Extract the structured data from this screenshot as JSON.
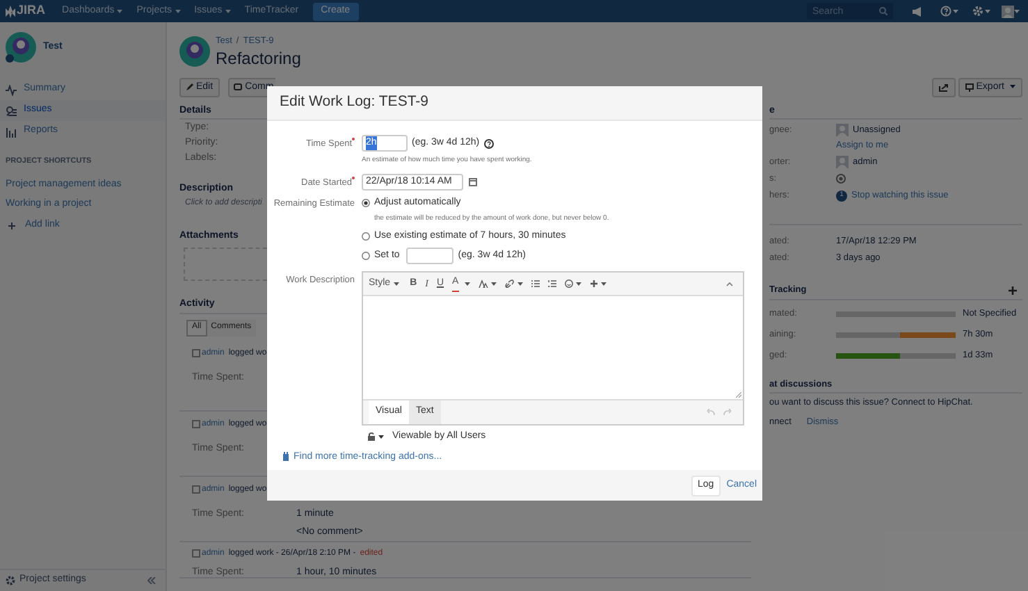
{
  "header": {
    "logo": "JIRA",
    "menus": [
      {
        "label": "Dashboards",
        "dropdown": true
      },
      {
        "label": "Projects",
        "dropdown": true
      },
      {
        "label": "Issues",
        "dropdown": true
      },
      {
        "label": "TimeTracker",
        "dropdown": false
      }
    ],
    "create": "Create",
    "search": {
      "placeholder": "Search"
    }
  },
  "sidebar": {
    "project": "Test",
    "items": [
      {
        "label": "Summary",
        "selected": false
      },
      {
        "label": "Issues",
        "selected": true
      },
      {
        "label": "Reports",
        "selected": false
      }
    ],
    "shortcuts_title": "PROJECT SHORTCUTS",
    "shortcuts": [
      "Project management ideas",
      "Working in a project"
    ],
    "add_link": "Add link",
    "settings": "Project settings"
  },
  "issue": {
    "breadcrumbs": [
      "Test",
      "TEST-9"
    ],
    "separator": "/",
    "title": "Refactoring",
    "actions": [
      "Edit",
      "Comm"
    ],
    "export": "Export"
  },
  "details": {
    "title": "Details",
    "fields": [
      "Type:",
      "Priority:",
      "Labels:"
    ]
  },
  "description": {
    "title": "Description",
    "placeholder": "Click to add descripti"
  },
  "attachments": {
    "title": "Attachments"
  },
  "activity": {
    "title": "Activity",
    "tabs": [
      {
        "label": "All",
        "selected": true
      },
      {
        "label": "Comments",
        "selected": false
      }
    ],
    "entries": [
      {
        "user": "admin",
        "text": "logged wo",
        "fields": [
          {
            "label": "Time Spent:"
          }
        ]
      },
      {
        "user": "admin",
        "text": "logged wo",
        "fields": [
          {
            "label": "Time Spent:"
          }
        ]
      },
      {
        "user": "admin",
        "text": "logged wo",
        "fields": [
          {
            "label": "Time Spent:",
            "value": "1 minute",
            "comment": "<No comment>"
          }
        ]
      },
      {
        "user": "admin",
        "text": "logged work - 26/Apr/18 2:10 PM -",
        "edited": "edited",
        "fields": [
          {
            "label": "Time Spent:",
            "value": "1 hour, 10 minutes"
          }
        ]
      }
    ]
  },
  "people": {
    "title": "e",
    "assignee": {
      "label": "gnee:",
      "value": "Unassigned",
      "action": "Assign to me"
    },
    "reporter": {
      "label": "orter:",
      "value": "admin"
    },
    "votes": {
      "label": "s:"
    },
    "watchers": {
      "label": "hers:",
      "count": "1",
      "action": "Stop watching this issue"
    }
  },
  "dates": [
    {
      "label": "ated:",
      "value": "17/Apr/18 12:29 PM"
    },
    {
      "label": "ated:",
      "value": "3 days ago"
    }
  ],
  "time_tracking": {
    "title": "Tracking",
    "rows": [
      {
        "label": "mated:",
        "kind": "empty",
        "value": "Not Specified"
      },
      {
        "label": "aining:",
        "kind": "remaining",
        "level": 0.47,
        "value": "7h 30m"
      },
      {
        "label": "ged:",
        "kind": "logged",
        "level": 0.54,
        "value": "1d 33m"
      }
    ]
  },
  "hipchat": {
    "title": "at discussions",
    "text": "ou want to discuss this issue? Connect to HipChat.",
    "connect": "nnect",
    "dismiss": "Dismiss"
  },
  "dialog": {
    "title": "Edit Work Log: TEST-9",
    "time_spent": {
      "label": "Time Spent",
      "required": true,
      "value": "2h",
      "example": "(eg. 3w 4d 12h)",
      "hint": "An estimate of how much time you have spent working."
    },
    "date_started": {
      "label": "Date Started",
      "required": true,
      "value": "22/Apr/18 10:14 AM"
    },
    "remaining_estimate": {
      "label": "Remaining Estimate",
      "options": [
        {
          "kind": "plain",
          "label": "Adjust automatically",
          "selected": true,
          "hint": "the estimate will be reduced by the amount of work done, but never below 0."
        },
        {
          "kind": "plain",
          "label": "Use existing estimate of 7 hours, 30 minutes",
          "selected": false
        },
        {
          "kind": "input",
          "label": "Set to",
          "selected": false,
          "example": "(eg. 3w 4d 12h)"
        }
      ]
    },
    "work_description": {
      "label": "Work Description",
      "style": "Style",
      "bold": "B",
      "italic": "I",
      "underline": "U",
      "text_color_label": "A",
      "tabs": [
        {
          "label": "Visual",
          "selected": true
        },
        {
          "label": "Text",
          "selected": false
        }
      ]
    },
    "visibility": "Viewable by All Users",
    "addons_link": "Find more time-tracking add-ons...",
    "submit": "Log",
    "cancel": "Cancel"
  }
}
